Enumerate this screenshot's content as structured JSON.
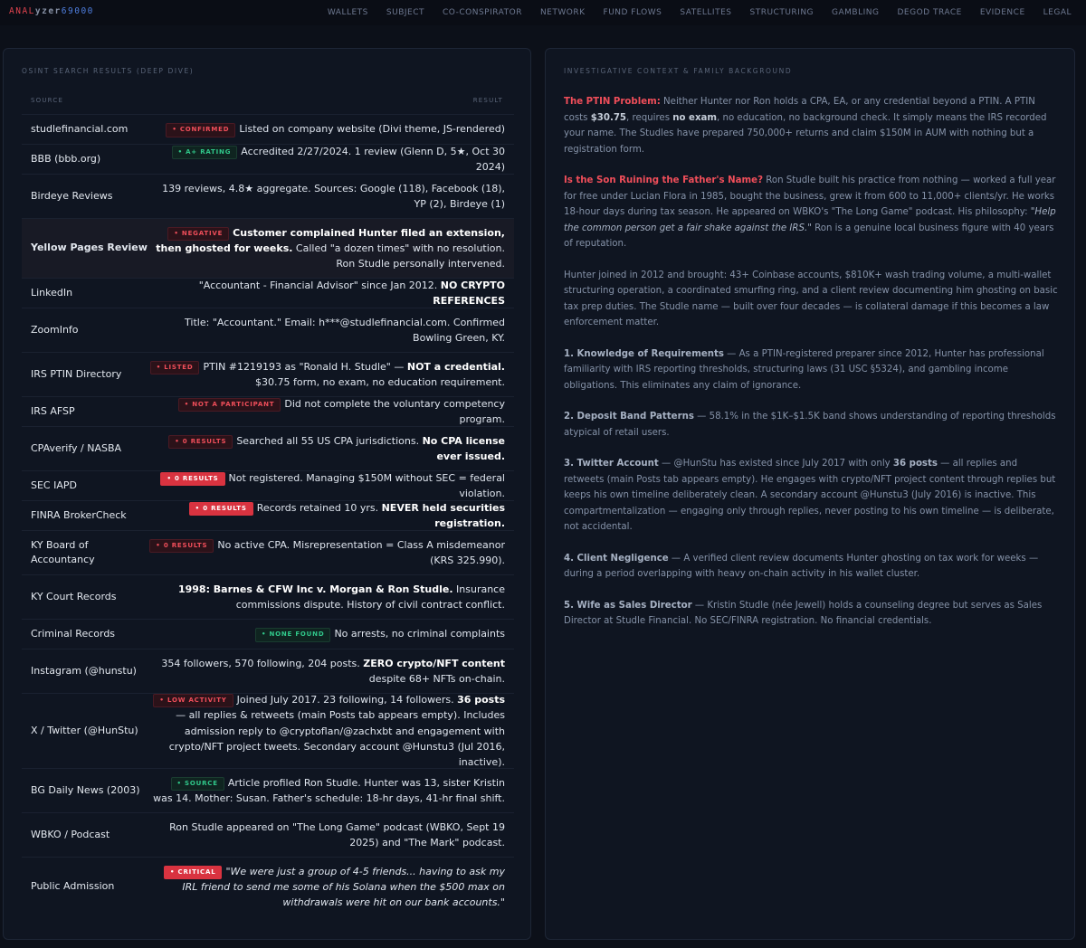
{
  "app": {
    "logo_part1": "ANAL",
    "logo_part2": "yzer",
    "logo_part3": "69000",
    "nav": [
      "WALLETS",
      "SUBJECT",
      "CO-CONSPIRATOR",
      "NETWORK",
      "FUND FLOWS",
      "SATELLITES",
      "STRUCTURING",
      "GAMBLING",
      "DEGOD TRACE",
      "EVIDENCE",
      "LEGAL"
    ]
  },
  "left_panel": {
    "title": "OSINT SEARCH RESULTS (DEEP DIVE)",
    "col_source": "SOURCE",
    "col_result": "RESULT",
    "rows": [
      {
        "source": "studlefinancial.com",
        "badge": "CONFIRMED",
        "t1": "Listed on company website (Divi theme, JS-rendered)"
      },
      {
        "source": "BBB (bbb.org)",
        "badge": "A+ RATING",
        "t1": "Accredited 2/27/2024. 1 review (Glenn D, 5★, Oct 30 2024)"
      },
      {
        "source": "Birdeye Reviews",
        "t1": "139 reviews, 4.8★ aggregate. Sources: Google (118), Facebook (18), YP (2), Birdeye (1)"
      },
      {
        "source": "Yellow Pages Review",
        "badge": "NEGATIVE",
        "b1": "Customer complained Hunter filed an extension, then ghosted for weeks.",
        "t1": " Called \"a dozen times\" with no resolution. Ron Studle personally intervened."
      },
      {
        "source": "LinkedIn",
        "t1": "\"Accountant - Financial Advisor\" since Jan 2012. ",
        "b1": "NO CRYPTO REFERENCES"
      },
      {
        "source": "ZoomInfo",
        "t1": "Title: \"Accountant.\" Email: h***@studlefinancial.com. Confirmed Bowling Green, KY."
      },
      {
        "source": "IRS PTIN Directory",
        "badge": "LISTED",
        "t1": "PTIN #1219193 as \"Ronald H. Studle\" — ",
        "b1": "NOT a credential.",
        "t2": " $30.75 form, no exam, no education requirement."
      },
      {
        "source": "IRS AFSP",
        "badge": "NOT A PARTICIPANT",
        "t1": "Did not complete the voluntary competency program."
      },
      {
        "source": "CPAverify / NASBA",
        "badge": "0 RESULTS",
        "t1": "Searched all 55 US CPA jurisdictions. ",
        "b1": "No CPA license ever issued."
      },
      {
        "source": "SEC IAPD",
        "badge": "0 RESULTS",
        "t1": "Not registered. Managing $150M without SEC = federal violation."
      },
      {
        "source": "FINRA BrokerCheck",
        "badge": "0 RESULTS",
        "t1": "Records retained 10 yrs. ",
        "b1": "NEVER held securities registration."
      },
      {
        "source": "KY Board of Accountancy",
        "badge": "0 RESULTS",
        "t1": "No active CPA. Misrepresentation = Class A misdemeanor (KRS 325.990)."
      },
      {
        "source": "KY Court Records",
        "b1": "1998: Barnes & CFW Inc v. Morgan & Ron Studle.",
        "t1": " Insurance commissions dispute. History of civil contract conflict."
      },
      {
        "source": "Criminal Records",
        "badge": "NONE FOUND",
        "t1": "No arrests, no criminal complaints"
      },
      {
        "source": "Instagram (@hunstu)",
        "t1": "354 followers, 570 following, 204 posts. ",
        "b1": "ZERO crypto/NFT content",
        "t2": " despite 68+ NFTs on-chain."
      },
      {
        "source": "X / Twitter (@HunStu)",
        "badge": "LOW ACTIVITY",
        "t1": "Joined July 2017. 23 following, 14 followers. ",
        "b1": "36 posts",
        "t2": " — all replies & retweets (main Posts tab appears empty). Includes admission reply to @cryptoflan/@zachxbt and engagement with crypto/NFT project tweets. Secondary account @Hunstu3 (Jul 2016, inactive)."
      },
      {
        "source": "BG Daily News (2003)",
        "badge": "SOURCE",
        "t1": "Article profiled Ron Studle. Hunter was 13, sister Kristin was 14. Mother: Susan. Father's schedule: 18-hr days, 41-hr final shift."
      },
      {
        "source": "WBKO / Podcast",
        "t1": "Ron Studle appeared on \"The Long Game\" podcast (WBKO, Sept 19 2025) and \"The Mark\" podcast."
      },
      {
        "source": "Public Admission",
        "badge": "CRITICAL",
        "i1": "\"We were just a group of 4-5 friends... having to ask my IRL friend to send me some of his Solana when the $500 max on withdrawals were hit on our bank accounts.\""
      }
    ]
  },
  "right_panel": {
    "title": "INVESTIGATIVE CONTEXT & FAMILY BACKGROUND",
    "p1": {
      "lead": "The PTIN Problem:",
      "a": " Neither Hunter nor Ron holds a CPA, EA, or any credential beyond a PTIN. A PTIN costs ",
      "b": "$30.75",
      "c": ", requires ",
      "d": "no exam",
      "e": ", no education, no background check. It simply means the IRS recorded your name. The Studles have prepared 750,000+ returns and claim $150M in AUM with nothing but a registration form."
    },
    "p2": {
      "lead": "Is the Son Ruining the Father's Name?",
      "a": " Ron Studle built his practice from nothing — worked a full year for free under Lucian Flora in 1985, bought the business, grew it from 600 to 11,000+ clients/yr. He works 18-hour days during tax season. He appeared on WBKO's \"The Long Game\" podcast. His philosophy: ",
      "quote": "\"Help the common person get a fair shake against the IRS.\"",
      "b": " Ron is a genuine local business figure with 40 years of reputation."
    },
    "p3": "Hunter joined in 2012 and brought: 43+ Coinbase accounts, $810K+ wash trading volume, a multi-wallet structuring operation, a coordinated smurfing ring, and a client review documenting him ghosting on basic tax prep duties. The Studle name — built over four decades — is collateral damage if this becomes a law enforcement matter.",
    "p4": {
      "lead": "1. Knowledge of Requirements",
      "a": " — As a PTIN-registered preparer since 2012, Hunter has professional familiarity with IRS reporting thresholds, structuring laws (31 USC §5324), and gambling income obligations. This eliminates any claim of ignorance."
    },
    "p5": {
      "lead": "2. Deposit Band Patterns",
      "a": " — 58.1% in the $1K–$1.5K band shows understanding of reporting thresholds atypical of retail users."
    },
    "p6": {
      "lead": "3. Twitter Account",
      "a": " — @HunStu has existed since July 2017 with only ",
      "b": "36 posts",
      "c": " — all replies and retweets (main Posts tab appears empty). He engages with crypto/NFT project content through replies but keeps his own timeline deliberately clean. A secondary account @Hunstu3 (July 2016) is inactive. This compartmentalization — engaging only through replies, never posting to his own timeline — is deliberate, not accidental."
    },
    "p7": {
      "lead": "4. Client Negligence",
      "a": " — A verified client review documents Hunter ghosting on tax work for weeks — during a period overlapping with heavy on-chain activity in his wallet cluster."
    },
    "p8": {
      "lead": "5. Wife as Sales Director",
      "a": " — Kristin Studle (née Jewell) holds a counseling degree but serves as Sales Director at Studle Financial. No SEC/FINRA registration. No financial credentials."
    }
  }
}
